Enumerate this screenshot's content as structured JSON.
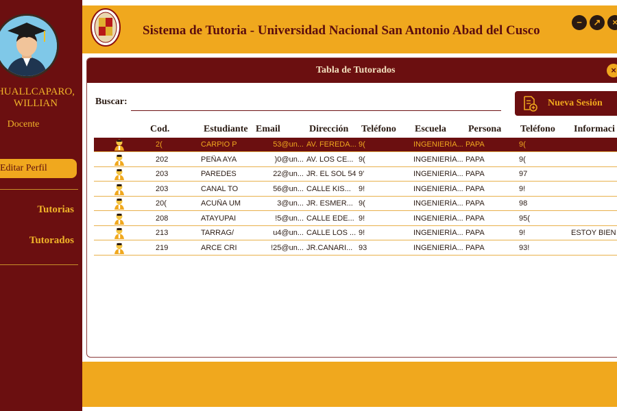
{
  "app": {
    "title": "Sistema de Tutoria - Universidad Nacional San Antonio Abad del Cusco"
  },
  "colors": {
    "maroon": "#6b0f10",
    "gold": "#f0a81e",
    "gold_text": "#f0b429"
  },
  "sidebar": {
    "user_name": "HUALLCAPARO, WILLIAN",
    "role": "Docente",
    "edit_profile": "Editar Perfil",
    "nav": [
      "Tutorias",
      "Tutorados"
    ]
  },
  "window_icons": [
    "minimize-icon",
    "maximize-icon",
    "close-icon"
  ],
  "panel": {
    "title": "Tabla de Tutorados",
    "search_label": "Buscar:",
    "search_value": "",
    "new_session": "Nueva Sesión",
    "columns": [
      "Cod.",
      "Estudiante",
      "Email",
      "Dirección",
      "Teléfono",
      "Escuela",
      "Persona",
      "Teléfono",
      "Informaci"
    ],
    "rows": [
      {
        "cod": "2(",
        "estudiante": "CARPIO P",
        "email": "53@un...",
        "direccion": "AV. FEREDA...",
        "telefono": "9(",
        "escuela": "INGENIERÍA...",
        "persona": "PAPA",
        "telefono2": "9(",
        "info": ""
      },
      {
        "cod": "202",
        "estudiante": "PEÑA AYA",
        "email": ")0@un...",
        "direccion": "AV. LOS CE...",
        "telefono": "9(",
        "escuela": "INGENIERÍA...",
        "persona": "PAPA",
        "telefono2": "9(",
        "info": ""
      },
      {
        "cod": "203",
        "estudiante": "PAREDES",
        "email": "22@un...",
        "direccion": "JR. EL SOL 54",
        "telefono": "9'",
        "escuela": "INGENIERÍA...",
        "persona": "PAPA",
        "telefono2": "97",
        "info": ""
      },
      {
        "cod": "203",
        "estudiante": "CANAL TO",
        "email": "56@un...",
        "direccion": "CALLE KIS...",
        "telefono": "9!",
        "escuela": "INGENIERÍA...",
        "persona": "PAPA",
        "telefono2": "9!",
        "info": ""
      },
      {
        "cod": "20(",
        "estudiante": "ACUÑA UM",
        "email": "3@un...",
        "direccion": "JR. ESMER...",
        "telefono": "9(",
        "escuela": "INGENIERÍA...",
        "persona": "PAPA",
        "telefono2": "98",
        "info": ""
      },
      {
        "cod": "208",
        "estudiante": "ATAYUPAI",
        "email": "!5@un...",
        "direccion": "CALLE EDE...",
        "telefono": "9!",
        "escuela": "INGENIERÍA...",
        "persona": "PAPA",
        "telefono2": "95(",
        "info": ""
      },
      {
        "cod": "213",
        "estudiante": "TARRAG/",
        "email": "u4@un...",
        "direccion": "CALLE LOS ...",
        "telefono": "9!",
        "escuela": "INGENIERÍA...",
        "persona": "PAPA",
        "telefono2": "9!",
        "info": "ESTOY BIEN"
      },
      {
        "cod": "219",
        "estudiante": "ARCE CRI",
        "email": "!25@un...",
        "direccion": "JR.CANARI...",
        "telefono": "93",
        "escuela": "INGENIERÍA...",
        "persona": "PAPA",
        "telefono2": "93!",
        "info": ""
      }
    ]
  }
}
